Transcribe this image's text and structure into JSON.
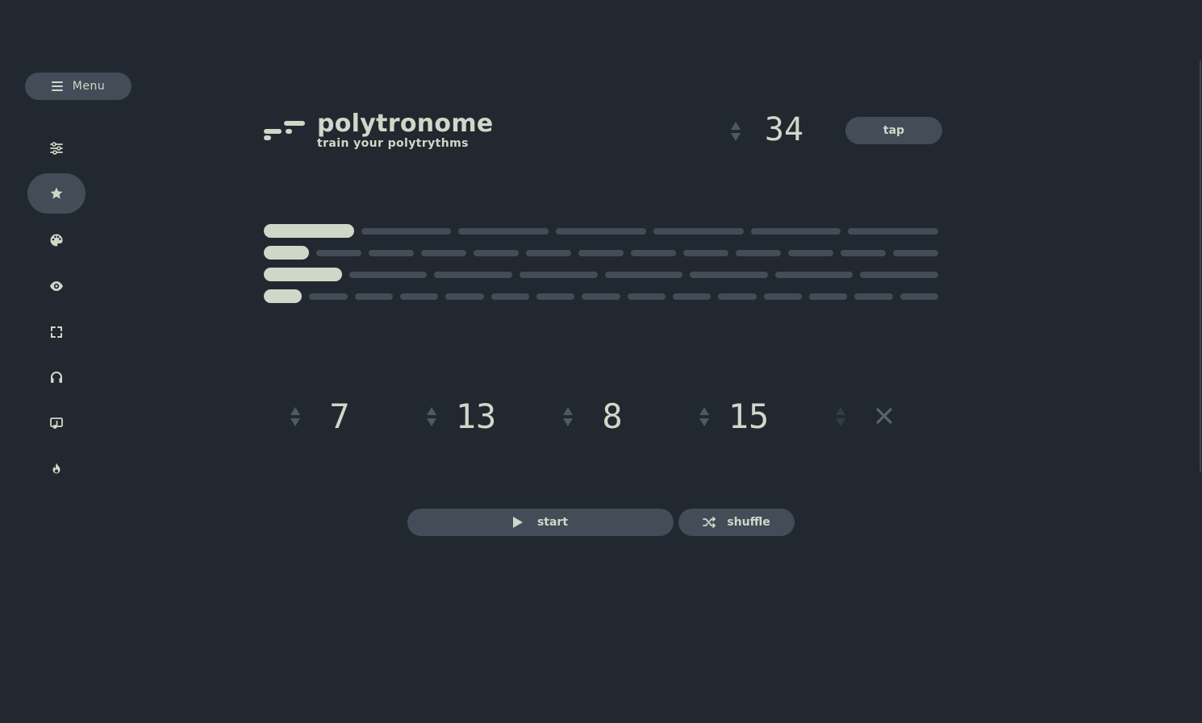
{
  "sidebar": {
    "menu_label": "Menu",
    "items": [
      {
        "icon": "sliders-icon",
        "active": false
      },
      {
        "icon": "star-icon",
        "active": true
      },
      {
        "icon": "palette-icon",
        "active": false
      },
      {
        "icon": "eye-icon",
        "active": false
      },
      {
        "icon": "fullscreen-icon",
        "active": false
      },
      {
        "icon": "headphones-icon",
        "active": false
      },
      {
        "icon": "music-note-icon",
        "active": false
      },
      {
        "icon": "flame-icon",
        "active": false
      }
    ]
  },
  "header": {
    "title": "polytronome",
    "subtitle": "train your polytrythms",
    "tempo": "34",
    "tap_label": "tap"
  },
  "rhythms": {
    "values": [
      "7",
      "13",
      "8",
      "15"
    ],
    "lanes": [
      7,
      13,
      8,
      15
    ]
  },
  "controls": {
    "start_label": "start",
    "shuffle_label": "shuffle"
  },
  "colors": {
    "background": "#22282f",
    "surface": "#434c57",
    "accent": "#cfd8c8"
  }
}
